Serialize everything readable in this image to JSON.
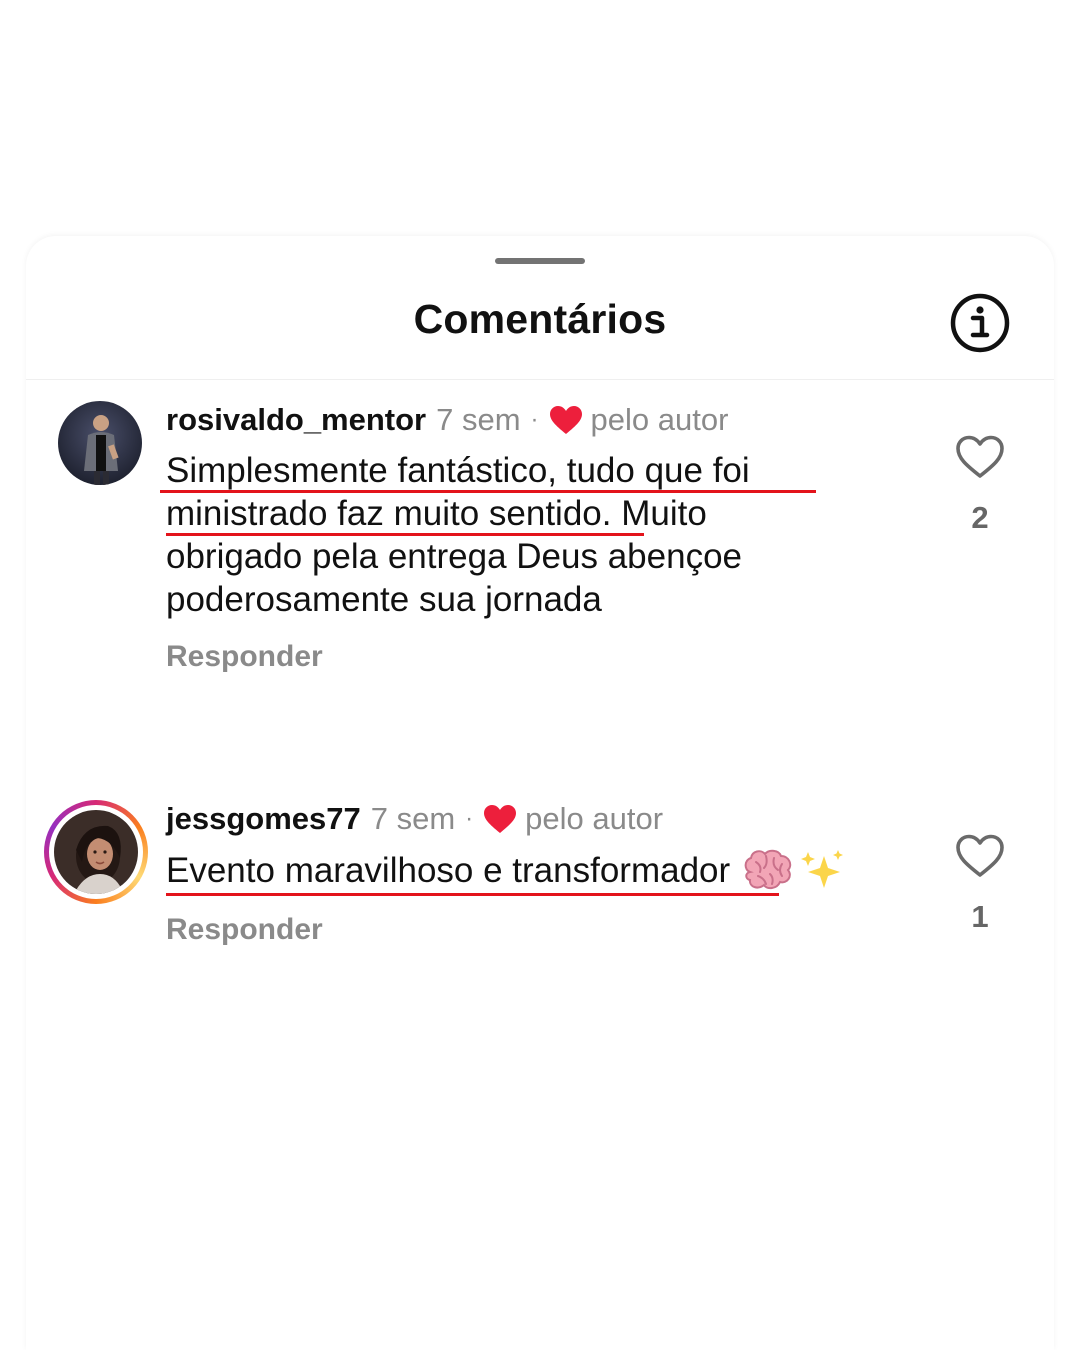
{
  "sheet": {
    "title": "Comentários"
  },
  "comments": [
    {
      "username": "rosivaldo_mentor",
      "time": "7 sem",
      "separator": "·",
      "by_author": "pelo autor",
      "text_lines": [
        "Simplesmente fantástico, tudo que foi",
        "ministrado faz muito sentido. Muito",
        "obrigado pela entrega Deus abençoe",
        "poderosamente sua jornada"
      ],
      "reply_label": "Responder",
      "like_count": "2"
    },
    {
      "username": "jessgomes77",
      "time": "7 sem",
      "separator": "·",
      "by_author": "pelo autor",
      "text": "Evento maravilhoso e transformador",
      "emojis": "🧠✨",
      "reply_label": "Responder",
      "like_count": "1"
    }
  ],
  "colors": {
    "heart_red": "#ed1f3c",
    "underline_red": "#e3131b",
    "muted_text": "#8a8a8a"
  },
  "icons": {
    "info": "info-circle-icon",
    "like": "heart-outline-icon",
    "author_like": "heart-filled-icon",
    "brain": "brain-emoji-icon",
    "sparkles": "sparkles-emoji-icon"
  }
}
